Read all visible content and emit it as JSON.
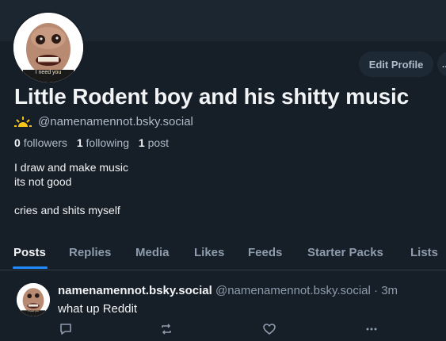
{
  "profile": {
    "display_name": "Little Rodent boy and his shitty music",
    "handle": "@namenamennot.bsky.social",
    "avatar_caption": "I need you",
    "followers_count": "0",
    "followers_label": "followers",
    "following_count": "1",
    "following_label": "following",
    "posts_count": "1",
    "posts_label": "post",
    "bio": "I draw and make music\nits not good\n\ncries and shits myself"
  },
  "actions": {
    "edit_profile": "Edit Profile",
    "more": "..."
  },
  "tabs": [
    "Posts",
    "Replies",
    "Media",
    "Likes",
    "Feeds",
    "Starter Packs",
    "Lists"
  ],
  "active_tab": "Posts",
  "post": {
    "author": "namenamennot.bsky.social",
    "handle": "@namenamennot.bsky.social",
    "time": "3m",
    "text": "what up Reddit",
    "avatar_caption": "I need you"
  },
  "colors": {
    "background": "#161e27",
    "accent": "#208bfe",
    "muted_text": "#8d9cad",
    "sun_emoji": "#f5c518"
  },
  "icons": [
    "sun-icon",
    "reply-icon",
    "repost-icon",
    "like-icon",
    "more-options-icon"
  ]
}
